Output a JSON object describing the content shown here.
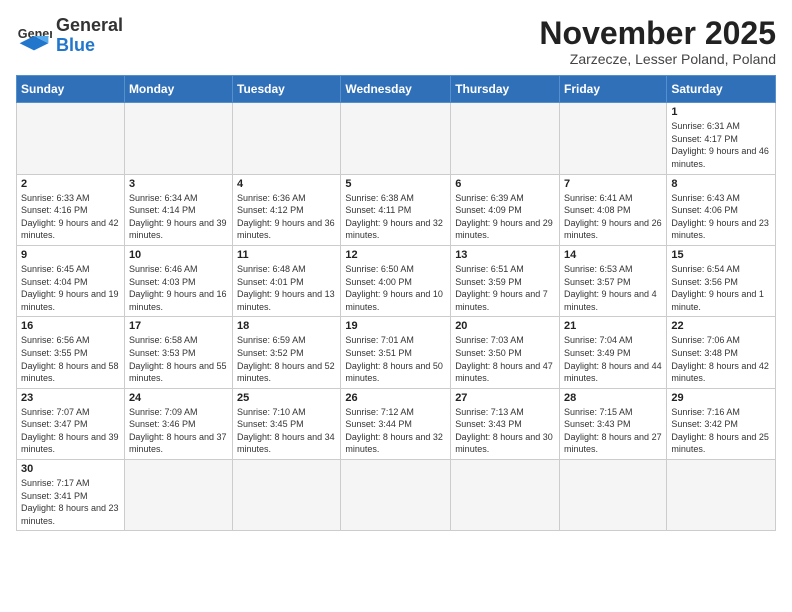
{
  "header": {
    "logo_general": "General",
    "logo_blue": "Blue",
    "month_title": "November 2025",
    "location": "Zarzecze, Lesser Poland, Poland"
  },
  "weekdays": [
    "Sunday",
    "Monday",
    "Tuesday",
    "Wednesday",
    "Thursday",
    "Friday",
    "Saturday"
  ],
  "days": {
    "1": {
      "sunrise": "6:31 AM",
      "sunset": "4:17 PM",
      "daylight": "9 hours and 46 minutes."
    },
    "2": {
      "sunrise": "6:33 AM",
      "sunset": "4:16 PM",
      "daylight": "9 hours and 42 minutes."
    },
    "3": {
      "sunrise": "6:34 AM",
      "sunset": "4:14 PM",
      "daylight": "9 hours and 39 minutes."
    },
    "4": {
      "sunrise": "6:36 AM",
      "sunset": "4:12 PM",
      "daylight": "9 hours and 36 minutes."
    },
    "5": {
      "sunrise": "6:38 AM",
      "sunset": "4:11 PM",
      "daylight": "9 hours and 32 minutes."
    },
    "6": {
      "sunrise": "6:39 AM",
      "sunset": "4:09 PM",
      "daylight": "9 hours and 29 minutes."
    },
    "7": {
      "sunrise": "6:41 AM",
      "sunset": "4:08 PM",
      "daylight": "9 hours and 26 minutes."
    },
    "8": {
      "sunrise": "6:43 AM",
      "sunset": "4:06 PM",
      "daylight": "9 hours and 23 minutes."
    },
    "9": {
      "sunrise": "6:45 AM",
      "sunset": "4:04 PM",
      "daylight": "9 hours and 19 minutes."
    },
    "10": {
      "sunrise": "6:46 AM",
      "sunset": "4:03 PM",
      "daylight": "9 hours and 16 minutes."
    },
    "11": {
      "sunrise": "6:48 AM",
      "sunset": "4:01 PM",
      "daylight": "9 hours and 13 minutes."
    },
    "12": {
      "sunrise": "6:50 AM",
      "sunset": "4:00 PM",
      "daylight": "9 hours and 10 minutes."
    },
    "13": {
      "sunrise": "6:51 AM",
      "sunset": "3:59 PM",
      "daylight": "9 hours and 7 minutes."
    },
    "14": {
      "sunrise": "6:53 AM",
      "sunset": "3:57 PM",
      "daylight": "9 hours and 4 minutes."
    },
    "15": {
      "sunrise": "6:54 AM",
      "sunset": "3:56 PM",
      "daylight": "9 hours and 1 minute."
    },
    "16": {
      "sunrise": "6:56 AM",
      "sunset": "3:55 PM",
      "daylight": "8 hours and 58 minutes."
    },
    "17": {
      "sunrise": "6:58 AM",
      "sunset": "3:53 PM",
      "daylight": "8 hours and 55 minutes."
    },
    "18": {
      "sunrise": "6:59 AM",
      "sunset": "3:52 PM",
      "daylight": "8 hours and 52 minutes."
    },
    "19": {
      "sunrise": "7:01 AM",
      "sunset": "3:51 PM",
      "daylight": "8 hours and 50 minutes."
    },
    "20": {
      "sunrise": "7:03 AM",
      "sunset": "3:50 PM",
      "daylight": "8 hours and 47 minutes."
    },
    "21": {
      "sunrise": "7:04 AM",
      "sunset": "3:49 PM",
      "daylight": "8 hours and 44 minutes."
    },
    "22": {
      "sunrise": "7:06 AM",
      "sunset": "3:48 PM",
      "daylight": "8 hours and 42 minutes."
    },
    "23": {
      "sunrise": "7:07 AM",
      "sunset": "3:47 PM",
      "daylight": "8 hours and 39 minutes."
    },
    "24": {
      "sunrise": "7:09 AM",
      "sunset": "3:46 PM",
      "daylight": "8 hours and 37 minutes."
    },
    "25": {
      "sunrise": "7:10 AM",
      "sunset": "3:45 PM",
      "daylight": "8 hours and 34 minutes."
    },
    "26": {
      "sunrise": "7:12 AM",
      "sunset": "3:44 PM",
      "daylight": "8 hours and 32 minutes."
    },
    "27": {
      "sunrise": "7:13 AM",
      "sunset": "3:43 PM",
      "daylight": "8 hours and 30 minutes."
    },
    "28": {
      "sunrise": "7:15 AM",
      "sunset": "3:43 PM",
      "daylight": "8 hours and 27 minutes."
    },
    "29": {
      "sunrise": "7:16 AM",
      "sunset": "3:42 PM",
      "daylight": "8 hours and 25 minutes."
    },
    "30": {
      "sunrise": "7:17 AM",
      "sunset": "3:41 PM",
      "daylight": "8 hours and 23 minutes."
    }
  },
  "labels": {
    "sunrise": "Sunrise:",
    "sunset": "Sunset:",
    "daylight": "Daylight:"
  }
}
